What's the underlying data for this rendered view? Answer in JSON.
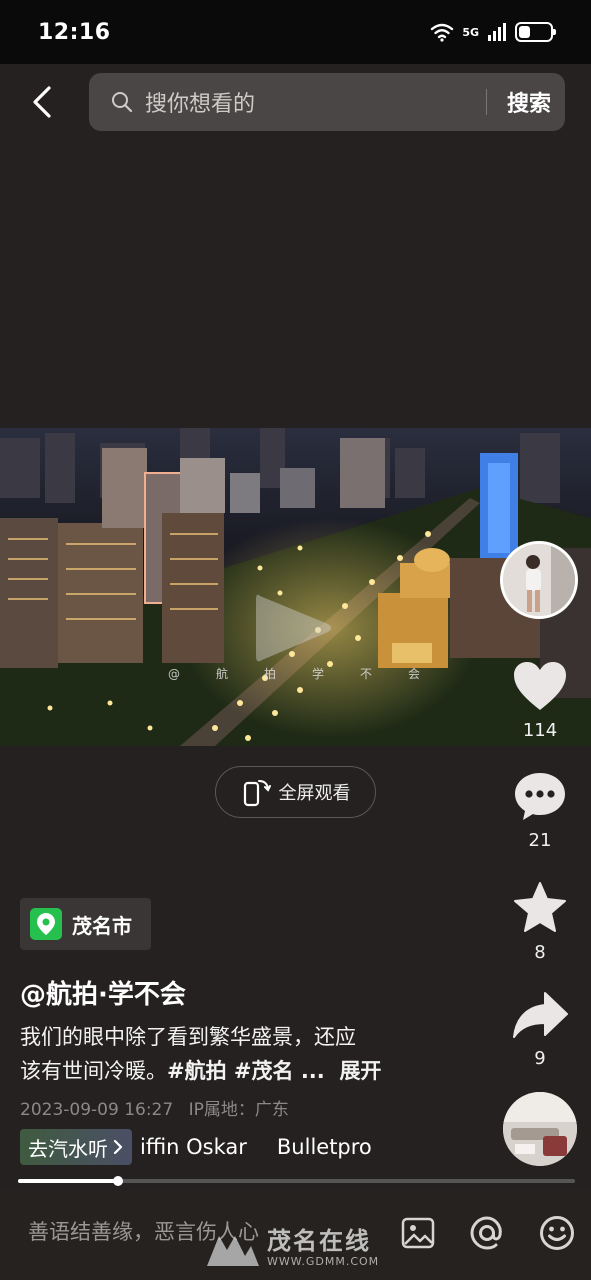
{
  "status": {
    "time": "12:16",
    "network": "5G",
    "battery_level": 0.45
  },
  "search": {
    "placeholder": "搜你想看的",
    "submit_label": "搜索"
  },
  "video": {
    "watermark": "@航拍学不会",
    "fullscreen_label": "全屏观看",
    "progress": 0.18
  },
  "actions": {
    "likes": "114",
    "comments": "21",
    "favorites": "8",
    "shares": "9"
  },
  "post": {
    "location": "茂名市",
    "author": "@航拍·学不会",
    "caption_line1": "我们的眼中除了看到繁华盛景，还应",
    "caption_line2_text": "该有世间冷暖。",
    "caption_tags": "#航拍 #茂名 ...",
    "expand_label": "展开",
    "date": "2023-09-09 16:27",
    "ip_label": "IP属地：广东"
  },
  "music": {
    "chip_label": "去汽水听",
    "track1": "iffin Oskar",
    "track2": "Bulletpro"
  },
  "comment_bar": {
    "placeholder": "善语结善缘，恶言伤人心"
  },
  "site_watermark": {
    "name": "茂名在线",
    "url": "WWW.GDMM.COM"
  },
  "colors": {
    "background": "#252120",
    "location_green": "#25c04e"
  }
}
